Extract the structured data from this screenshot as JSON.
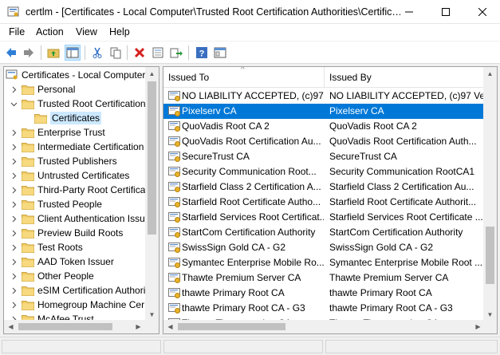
{
  "window": {
    "title": "certlm - [Certificates - Local Computer\\Trusted Root Certification Authorities\\Certific…"
  },
  "menu": [
    "File",
    "Action",
    "View",
    "Help"
  ],
  "toolbar": {
    "icons": [
      "back-arrow-icon",
      "forward-arrow-icon",
      "up-folder-icon",
      "show-hide-tree-icon",
      "cut-icon",
      "copy-icon",
      "delete-icon",
      "properties-icon",
      "export-icon",
      "help-icon",
      "console-icon"
    ]
  },
  "tree": {
    "root": "Certificates - Local Computer",
    "items": [
      {
        "label": "Personal",
        "expanded": false
      },
      {
        "label": "Trusted Root Certification",
        "expanded": true
      },
      {
        "label": "Certificates",
        "child": true,
        "selected": true
      },
      {
        "label": "Enterprise Trust",
        "expanded": false
      },
      {
        "label": "Intermediate Certification",
        "expanded": false
      },
      {
        "label": "Trusted Publishers",
        "expanded": false
      },
      {
        "label": "Untrusted Certificates",
        "expanded": false
      },
      {
        "label": "Third-Party Root Certificat",
        "expanded": false
      },
      {
        "label": "Trusted People",
        "expanded": false
      },
      {
        "label": "Client Authentication Issu",
        "expanded": false
      },
      {
        "label": "Preview Build Roots",
        "expanded": false
      },
      {
        "label": "Test Roots",
        "expanded": false
      },
      {
        "label": "AAD Token Issuer",
        "expanded": false
      },
      {
        "label": "Other People",
        "expanded": false
      },
      {
        "label": "eSIM Certification Authori",
        "expanded": false
      },
      {
        "label": "Homegroup Machine Cer",
        "expanded": false
      },
      {
        "label": "McAfee Trust",
        "expanded": false
      }
    ]
  },
  "list": {
    "columns": [
      "Issued To",
      "Issued By"
    ],
    "rows": [
      {
        "to": "NO LIABILITY ACCEPTED, (c)97 ...",
        "by": "NO LIABILITY ACCEPTED, (c)97 Ve..."
      },
      {
        "to": "Pixelserv CA",
        "by": "Pixelserv CA",
        "selected": true
      },
      {
        "to": "QuoVadis Root CA 2",
        "by": "QuoVadis Root CA 2"
      },
      {
        "to": "QuoVadis Root Certification Au...",
        "by": "QuoVadis Root Certification Auth..."
      },
      {
        "to": "SecureTrust CA",
        "by": "SecureTrust CA"
      },
      {
        "to": "Security Communication Root...",
        "by": "Security Communication RootCA1"
      },
      {
        "to": "Starfield Class 2 Certification A...",
        "by": "Starfield Class 2 Certification Au..."
      },
      {
        "to": "Starfield Root Certificate Autho...",
        "by": "Starfield Root Certificate Authorit..."
      },
      {
        "to": "Starfield Services Root Certificat...",
        "by": "Starfield Services Root Certificate ..."
      },
      {
        "to": "StartCom Certification Authority",
        "by": "StartCom Certification Authority"
      },
      {
        "to": "SwissSign Gold CA - G2",
        "by": "SwissSign Gold CA - G2"
      },
      {
        "to": "Symantec Enterprise Mobile Ro...",
        "by": "Symantec Enterprise Mobile Root ..."
      },
      {
        "to": "Thawte Premium Server CA",
        "by": "Thawte Premium Server CA"
      },
      {
        "to": "thawte Primary Root CA",
        "by": "thawte Primary Root CA"
      },
      {
        "to": "thawte Primary Root CA - G3",
        "by": "thawte Primary Root CA - G3"
      },
      {
        "to": "Thawte Timestamping CA",
        "by": "Thawte Timestamping CA"
      }
    ]
  },
  "colors": {
    "selection": "#0078d7",
    "tree_selection": "#cce8ff",
    "folder": "#e8c45c"
  }
}
